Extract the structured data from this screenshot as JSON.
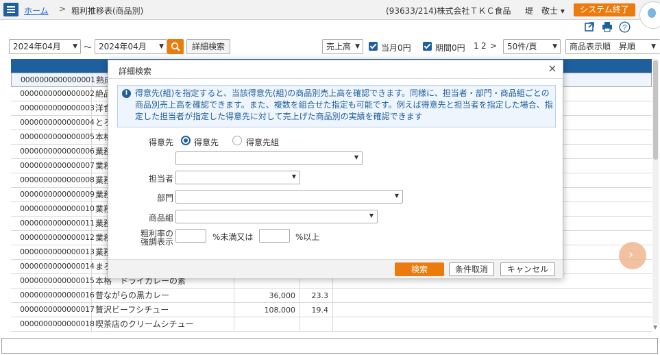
{
  "header": {
    "home_link": "ホーム",
    "separator": ">",
    "page_title": "粗利推移表(商品別)",
    "company": "(93633/214)株式会社ＴＫＣ食品",
    "user_name": "堤　敬士 ▾",
    "system_end_label": "システム終了"
  },
  "toolbar_icons": [
    "external-link-icon",
    "print-icon",
    "help-icon"
  ],
  "filters": {
    "period_from": "2024年04月",
    "range_sep": "～",
    "period_to": "2024年04月",
    "detail_search_label": "詳細検索",
    "metric": "売上高",
    "checkbox_current_zero": "当月0円",
    "checkbox_period_zero": "期間0円",
    "page_current": "1",
    "page_next": "2",
    "page_next_arrow": ">",
    "per_page": "50件/頁",
    "sort": "商品表示順　昇順"
  },
  "table": {
    "rows": [
      {
        "code": "0000000000000001",
        "name": "熟成",
        "amount": "",
        "rate": ""
      },
      {
        "code": "0000000000000002",
        "name": "絶品",
        "amount": "",
        "rate": ""
      },
      {
        "code": "0000000000000003",
        "name": "洋食",
        "amount": "",
        "rate": ""
      },
      {
        "code": "0000000000000004",
        "name": "とろ",
        "amount": "",
        "rate": ""
      },
      {
        "code": "0000000000000005",
        "name": "本格",
        "amount": "",
        "rate": ""
      },
      {
        "code": "0000000000000006",
        "name": "業務",
        "amount": "",
        "rate": ""
      },
      {
        "code": "0000000000000007",
        "name": "業務",
        "amount": "",
        "rate": ""
      },
      {
        "code": "0000000000000008",
        "name": "業務",
        "amount": "",
        "rate": ""
      },
      {
        "code": "0000000000000009",
        "name": "業務",
        "amount": "",
        "rate": ""
      },
      {
        "code": "0000000000000010",
        "name": "業務",
        "amount": "",
        "rate": ""
      },
      {
        "code": "0000000000000011",
        "name": "業務",
        "amount": "",
        "rate": ""
      },
      {
        "code": "0000000000000012",
        "name": "業務",
        "amount": "",
        "rate": ""
      },
      {
        "code": "0000000000000013",
        "name": "業務",
        "amount": "",
        "rate": ""
      },
      {
        "code": "0000000000000014",
        "name": "まろ",
        "amount": "",
        "rate": ""
      },
      {
        "code": "0000000000000015",
        "name": "本格　ドライカレーの素",
        "amount": "",
        "rate": ""
      },
      {
        "code": "0000000000000016",
        "name": "昔ながらの黒カレー",
        "amount": "36,000",
        "rate": "23.3"
      },
      {
        "code": "0000000000000017",
        "name": "贅沢ビーフシチュー",
        "amount": "108,000",
        "rate": "19.4"
      },
      {
        "code": "0000000000000018",
        "name": "喫茶店のクリームシチュー",
        "amount": "",
        "rate": ""
      }
    ]
  },
  "modal": {
    "title": "詳細検索",
    "close": "×",
    "info_text": "得意先(組)を指定すると、当該得意先(組)の商品別売上高を確認できます。同様に、担当者・部門・商品組ごとの商品別売上高を確認できます。また、複数を組合せた指定も可能です。例えば得意先と担当者を指定した場合、指定した担当者が指定した得意先に対して売上げた商品別の実績を確認できます",
    "customer_label": "得意先",
    "radio_customer": "得意先",
    "radio_customer_group": "得意先組",
    "staff_label": "担当者",
    "dept_label": "部門",
    "product_group_label": "商品組",
    "margin_label_1": "粗利率の",
    "margin_label_2": "強調表示",
    "below_label": "%未満又は",
    "above_label": "%以上",
    "btn_search": "検索",
    "btn_clear": "条件取消",
    "btn_cancel": "キャンセル"
  },
  "colors": {
    "primary_blue": "#1f5f9e",
    "accent_orange": "#ec7b0e",
    "info_bg": "#eef5fc"
  }
}
